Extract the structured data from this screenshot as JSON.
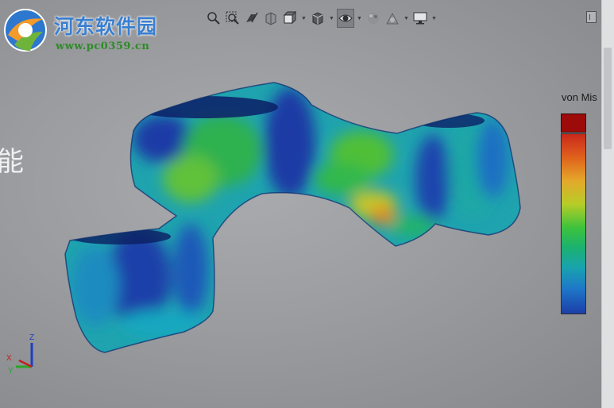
{
  "watermark": {
    "title": "河东软件园",
    "url": "www.pc0359.cn"
  },
  "toolbar": {
    "items": [
      {
        "name": "zoom-to-fit-icon",
        "has_dropdown": false
      },
      {
        "name": "zoom-area-icon",
        "has_dropdown": false
      },
      {
        "name": "previous-view-icon",
        "has_dropdown": false
      },
      {
        "name": "section-view-icon",
        "has_dropdown": false
      },
      {
        "name": "view-orientation-icon",
        "has_dropdown": true
      },
      {
        "name": "display-style-icon",
        "has_dropdown": true
      },
      {
        "name": "hide-show-items-icon",
        "has_dropdown": true,
        "active": true
      },
      {
        "name": "edit-appearance-icon",
        "has_dropdown": false
      },
      {
        "name": "apply-scene-icon",
        "has_dropdown": true
      },
      {
        "name": "view-settings-icon",
        "has_dropdown": true
      }
    ]
  },
  "legend": {
    "title": "von Mis",
    "tick_labels": [
      "",
      "",
      "",
      "",
      "",
      "",
      "",
      "",
      "",
      ""
    ]
  },
  "left_fragment": "能",
  "triad": {
    "x": "X",
    "y": "Y",
    "z": "Z"
  },
  "colors": {
    "background": "#9a9c9f",
    "legend_max": "#9c0a0a",
    "watermark_blue": "#3a7fd0",
    "watermark_green": "#2f8a28"
  }
}
